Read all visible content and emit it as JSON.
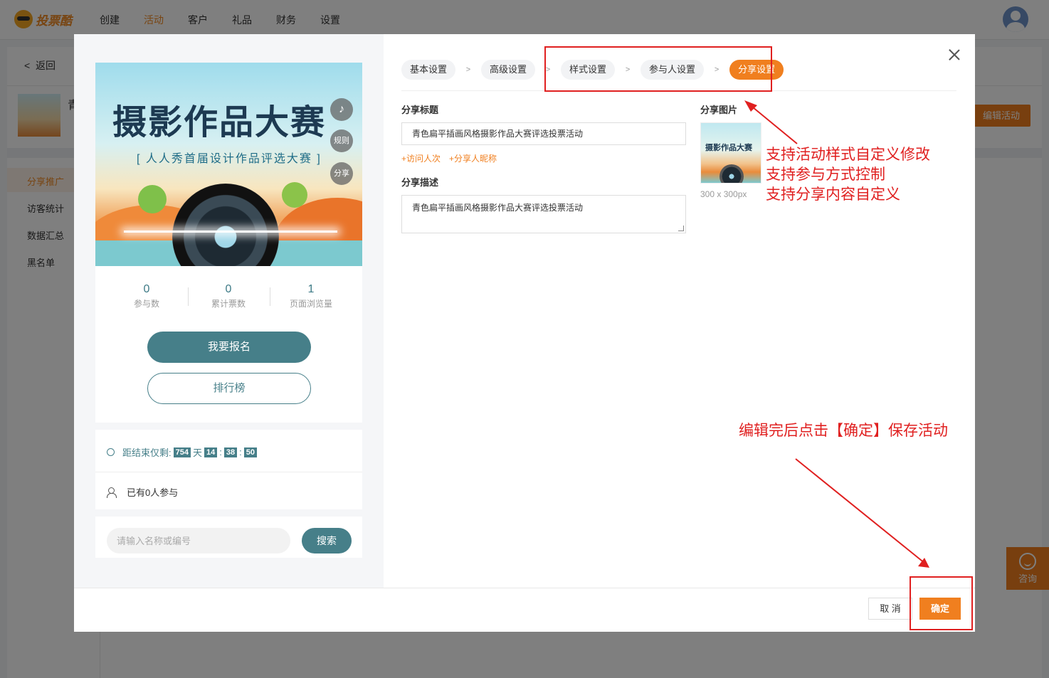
{
  "app": {
    "logo_text": "投票酷",
    "nav": [
      "创建",
      "活动",
      "客户",
      "礼品",
      "财务",
      "设置"
    ],
    "active_nav": "活动"
  },
  "background": {
    "back_label": "返回",
    "title_fragment": "青",
    "sidebar": [
      "分享推广",
      "访客统计",
      "数据汇总",
      "黑名单"
    ],
    "edit_button": "编辑活动",
    "consult_label": "咨询"
  },
  "preview": {
    "poster_title": "摄影作品大赛",
    "poster_subtitle": "[ 人人秀首届设计作品评选大赛 ]",
    "float_buttons": {
      "rules": "规则",
      "share": "分享"
    },
    "stats": [
      {
        "value": "0",
        "label": "参与数"
      },
      {
        "value": "0",
        "label": "累计票数"
      },
      {
        "value": "1",
        "label": "页面浏览量"
      }
    ],
    "signup_button": "我要报名",
    "rank_button": "排行榜",
    "countdown": {
      "prefix": "距结束仅剩:",
      "days": "754",
      "days_unit": "天",
      "hours": "14",
      "minutes": "38",
      "seconds": "50",
      "sep": ":"
    },
    "participants_text": "已有0人参与",
    "search_placeholder": "请输入名称或编号",
    "search_button": "搜索"
  },
  "steps": [
    {
      "label": "基本设置",
      "active": false
    },
    {
      "label": "高级设置",
      "active": false
    },
    {
      "label": "样式设置",
      "active": false
    },
    {
      "label": "参与人设置",
      "active": false
    },
    {
      "label": "分享设置",
      "active": true
    }
  ],
  "step_separator": ">",
  "form": {
    "share_title_label": "分享标题",
    "share_title_value": "青色扁平插画风格摄影作品大赛评选投票活动",
    "variables": [
      "+访问人次",
      "+分享人昵称"
    ],
    "share_desc_label": "分享描述",
    "share_desc_value": "青色扁平插画风格摄影作品大赛评选投票活动",
    "share_image_label": "分享图片",
    "share_image_title": "摄影作品大赛",
    "share_image_hint": "300 x 300px"
  },
  "footer": {
    "cancel_label": "取 消",
    "confirm_label": "确定"
  },
  "annotations": {
    "features": [
      "支持活动样式自定义修改",
      "支持参与方式控制",
      "支持分享内容自定义"
    ],
    "save_hint": "编辑完后点击【确定】保存活动"
  },
  "colors": {
    "accent": "#f07f1f",
    "teal": "#467f89",
    "annotation_red": "#e02020"
  }
}
